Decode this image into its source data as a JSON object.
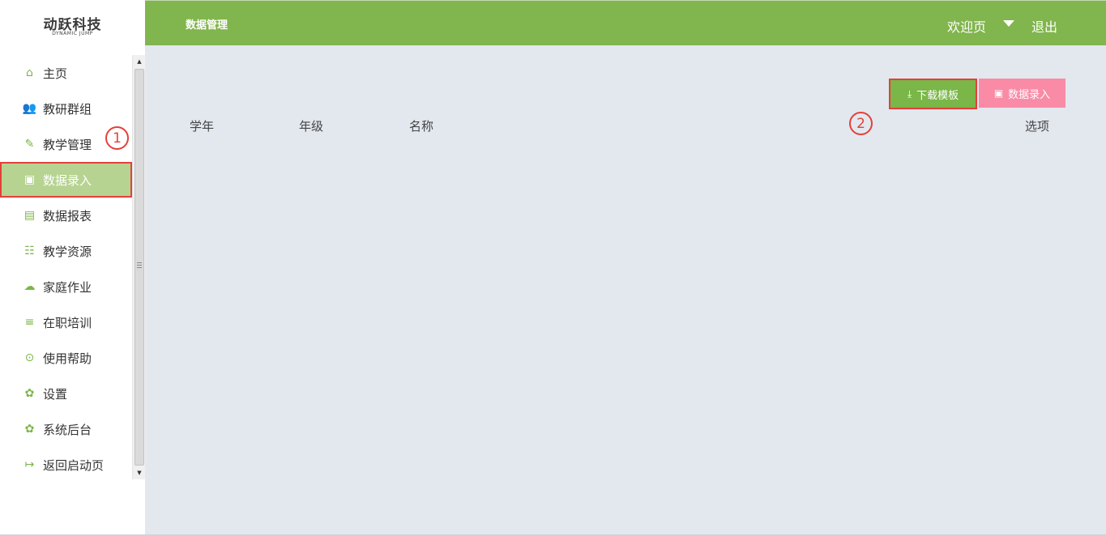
{
  "logo": {
    "main": "动跃科技",
    "sub": "DYNAMIC JUMP"
  },
  "sidebar": {
    "items": [
      {
        "label": "主页",
        "icon": "home-icon",
        "glyph": "⌂"
      },
      {
        "label": "教研群组",
        "icon": "users-icon",
        "glyph": "👥"
      },
      {
        "label": "教学管理",
        "icon": "edit-book-icon",
        "glyph": "✎"
      },
      {
        "label": "数据录入",
        "icon": "monitor-icon",
        "glyph": "▣",
        "active": true
      },
      {
        "label": "数据报表",
        "icon": "report-icon",
        "glyph": "▤"
      },
      {
        "label": "教学资源",
        "icon": "list-icon",
        "glyph": "☷"
      },
      {
        "label": "家庭作业",
        "icon": "cloud-icon",
        "glyph": "☁"
      },
      {
        "label": "在职培训",
        "icon": "notes-icon",
        "glyph": "≡"
      },
      {
        "label": "使用帮助",
        "icon": "help-dots-icon",
        "glyph": "⊙"
      },
      {
        "label": "设置",
        "icon": "gear-icon",
        "glyph": "✿"
      },
      {
        "label": "系统后台",
        "icon": "gear-icon",
        "glyph": "✿"
      },
      {
        "label": "返回启动页",
        "icon": "exit-icon",
        "glyph": "↦"
      }
    ]
  },
  "header": {
    "title": "数据管理",
    "welcome": "欢迎页",
    "logout": "退出"
  },
  "toolbar": {
    "download_label": "下载模板",
    "import_label": "数据录入"
  },
  "table": {
    "columns": [
      "学年",
      "年级",
      "名称",
      "选项"
    ]
  },
  "markers": {
    "one": "1",
    "two": "2"
  },
  "colors": {
    "header": "#81b54d",
    "active_nav": "#b6d391",
    "download_btn": "#7ab648",
    "import_btn": "#f98ba6",
    "highlight": "#e4403a"
  }
}
